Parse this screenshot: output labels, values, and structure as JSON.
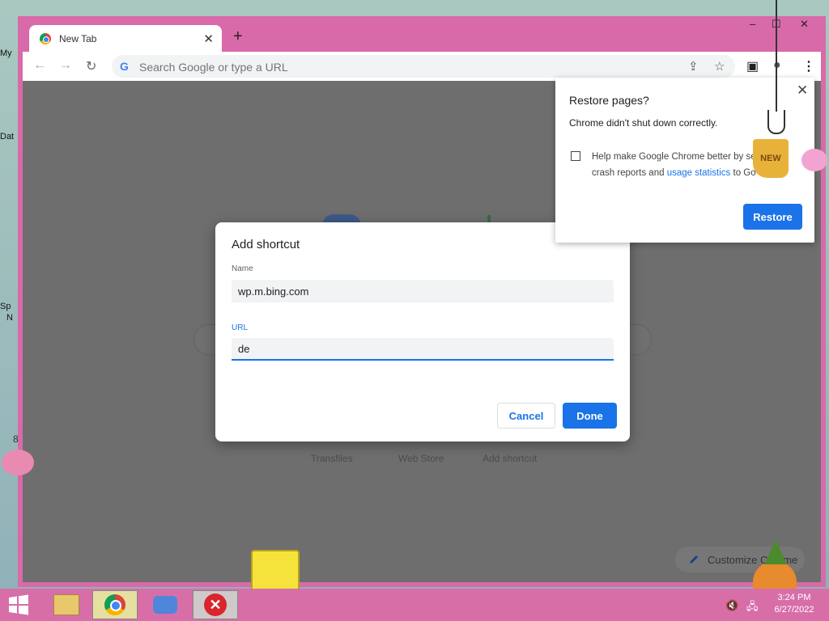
{
  "desktop": {
    "icon_labels": [
      "My",
      "Dat",
      "Sp",
      "N"
    ]
  },
  "browser": {
    "tab": {
      "title": "New Tab",
      "close": "✕"
    },
    "new_tab": "+",
    "window_controls": {
      "minimize": "–",
      "maximize": "☐",
      "close": "✕"
    },
    "toolbar": {
      "back": "←",
      "forward": "→",
      "reload": "↻",
      "omnibox_placeholder": "Search Google or type a URL",
      "omnibox_g": "G",
      "share": "⇪",
      "bookmark": "☆",
      "side_panel": "▣",
      "profile": "●",
      "menu": "⋮"
    },
    "ntp": {
      "shortcut_labels": [
        "Transfiles",
        "Web Store",
        "Add shortcut"
      ],
      "customize_label": "Customize Chrome",
      "customize_icon": "pencil-icon"
    }
  },
  "add_shortcut_dialog": {
    "title": "Add shortcut",
    "name_label": "Name",
    "name_value": "wp.m.bing.com",
    "url_label": "URL",
    "url_value": "de",
    "cancel_label": "Cancel",
    "done_label": "Done"
  },
  "restore_bubble": {
    "title": "Restore pages?",
    "message": "Chrome didn't shut down correctly.",
    "help_text_1": "Help make Google Chrome better by se",
    "help_text_2": "crash reports and ",
    "help_link": "usage statistics",
    "help_text_3": " to Go",
    "close": "✕",
    "restore_label": "Restore",
    "checkbox_checked": false
  },
  "taskbar": {
    "start_icon": "windows-start-icon",
    "apps": [
      "file-explorer-icon",
      "chrome-icon",
      "app-icon",
      "error-icon"
    ],
    "tray": {
      "volume": "🔇",
      "network": "🖧"
    },
    "clock": {
      "time": "3:24 PM",
      "date": "6/27/2022"
    }
  },
  "decorations": {
    "new_badge": "NEW",
    "snail_number": "8"
  },
  "colors": {
    "window_frame": "#d96aa9",
    "accent": "#1a73e8",
    "taskbar": "#d76ea8",
    "ntp_overlay": "#6e6e6e"
  }
}
